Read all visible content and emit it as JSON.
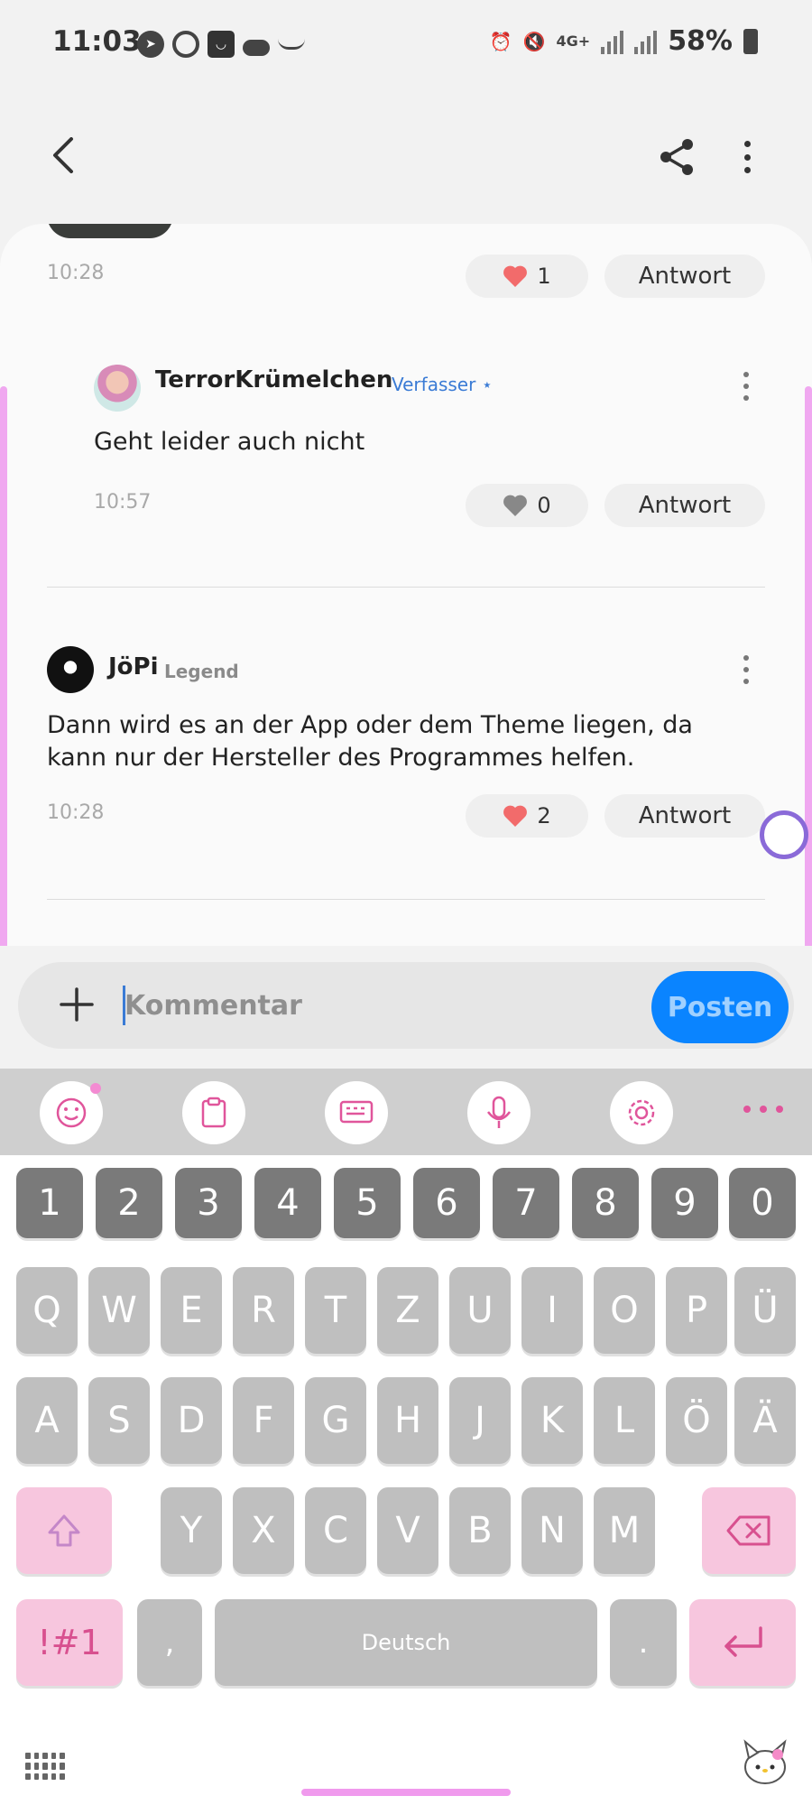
{
  "status_bar": {
    "time": "11:03",
    "network": "4G+",
    "battery": "58%"
  },
  "thread": {
    "first_item": {
      "time": "10:28",
      "likes": "1"
    },
    "reply_1": {
      "author": "TerrorKrümelchen",
      "role": "Verfasser ⋆",
      "text": "Geht leider auch nicht",
      "time": "10:57",
      "likes": "0"
    },
    "reply_2": {
      "author": "JöPi",
      "role": "Legend",
      "text": "Dann wird es an der App oder dem Theme liegen, da kann nur der Hersteller des Programmes helfen.",
      "time": "10:28",
      "likes": "2"
    },
    "reply_label": "Antwort"
  },
  "composer": {
    "placeholder": "Kommentar",
    "post_label": "Posten"
  },
  "keyboard": {
    "number_row": [
      "1",
      "2",
      "3",
      "4",
      "5",
      "6",
      "7",
      "8",
      "9",
      "0"
    ],
    "row_1": [
      "Q",
      "W",
      "E",
      "R",
      "T",
      "Z",
      "U",
      "I",
      "O",
      "P",
      "Ü"
    ],
    "row_2": [
      "A",
      "S",
      "D",
      "F",
      "G",
      "H",
      "J",
      "K",
      "L",
      "Ö",
      "Ä"
    ],
    "row_3": [
      "Y",
      "X",
      "C",
      "V",
      "B",
      "N",
      "M"
    ],
    "symbols_label": "!#1",
    "comma": ",",
    "space_label": "Deutsch",
    "period": "."
  },
  "colors": {
    "accent_blue": "#0a84ff",
    "heart_red": "#f26b6b",
    "keyboard_pink": "#f7c6de"
  }
}
